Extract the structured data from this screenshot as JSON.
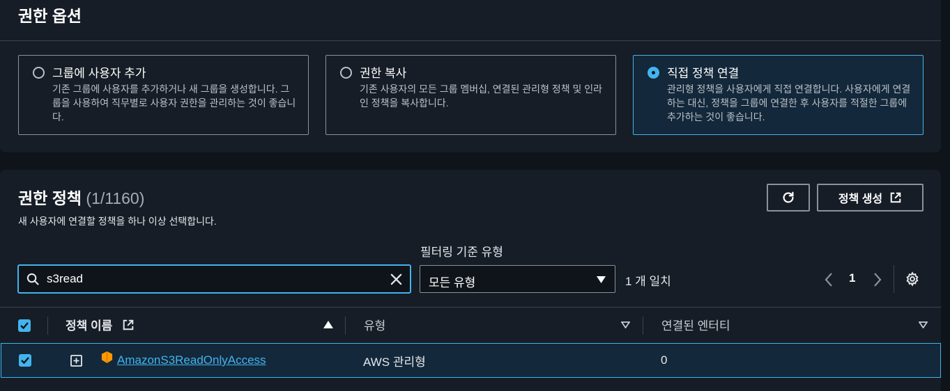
{
  "options": {
    "title": "권한 옵션",
    "cards": [
      {
        "title": "그룹에 사용자 추가",
        "desc": "기존 그룹에 사용자를 추가하거나 새 그룹을 생성합니다. 그룹을 사용하여 직무별로 사용자 권한을 관리하는 것이 좋습니다.",
        "selected": false
      },
      {
        "title": "권한 복사",
        "desc": "기존 사용자의 모든 그룹 멤버십, 연결된 관리형 정책 및 인라인 정책을 복사합니다.",
        "selected": false
      },
      {
        "title": "직접 정책 연결",
        "desc": "관리형 정책을 사용자에게 직접 연결합니다. 사용자에게 연결하는 대신, 정책을 그룹에 연결한 후 사용자를 적절한 그룹에 추가하는 것이 좋습니다.",
        "selected": true
      }
    ]
  },
  "policies": {
    "title": "권한 정책",
    "count": "(1/1160)",
    "subtitle": "새 사용자에 연결할 정책을 하나 이상 선택합니다.",
    "create_label": "정책 생성",
    "filter_label": "필터링 기준 유형",
    "search_value": "s3read",
    "type_select": "모든 유형",
    "match_count": "1 개 일치",
    "page": "1",
    "columns": {
      "name": "정책 이름",
      "type": "유형",
      "entities": "연결된 엔터티"
    },
    "rows": [
      {
        "name": "AmazonS3ReadOnlyAccess",
        "type": "AWS 관리형",
        "entities": "0"
      }
    ]
  },
  "colors": {
    "accent": "#42b4ee",
    "background": "#0f141a",
    "panel": "#161d26",
    "aws_orange": "#ff9900"
  }
}
